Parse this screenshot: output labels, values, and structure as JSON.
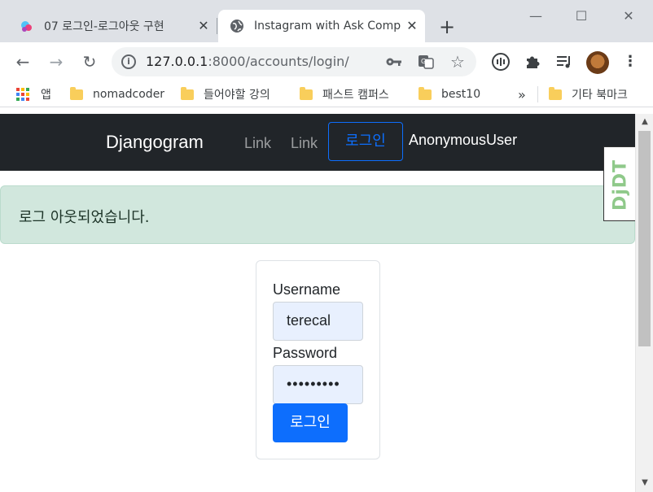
{
  "tabs": [
    {
      "title": "07 로그인-로그아웃 구현",
      "active": false
    },
    {
      "title": "Instagram with Ask Comp",
      "active": true
    }
  ],
  "toolbar": {
    "url_host": "127.0.0.1",
    "url_path": ":8000/accounts/login/"
  },
  "bookmarks": {
    "apps_label": "앱",
    "items": [
      "nomadcoder",
      "들어야할 강의",
      "패스트 캠퍼스",
      "best10"
    ],
    "overflow": "»",
    "other": "기타 북마크"
  },
  "navbar": {
    "brand": "Djangogram",
    "link1": "Link",
    "link2": "Link",
    "login": "로그인",
    "user": "AnonymousUser"
  },
  "alert": {
    "message": "로그 아웃되었습니다."
  },
  "form": {
    "username_label": "Username",
    "username_value": "terecal",
    "password_label": "Password",
    "password_value": "•••••••••",
    "submit_label": "로그인"
  },
  "debug_toolbar": {
    "label": "DjDT"
  },
  "colors": {
    "navbar_bg": "#212529",
    "primary": "#0d6efd",
    "alert_bg": "#d1e7dd",
    "autofill_bg": "#e8f0fe"
  }
}
